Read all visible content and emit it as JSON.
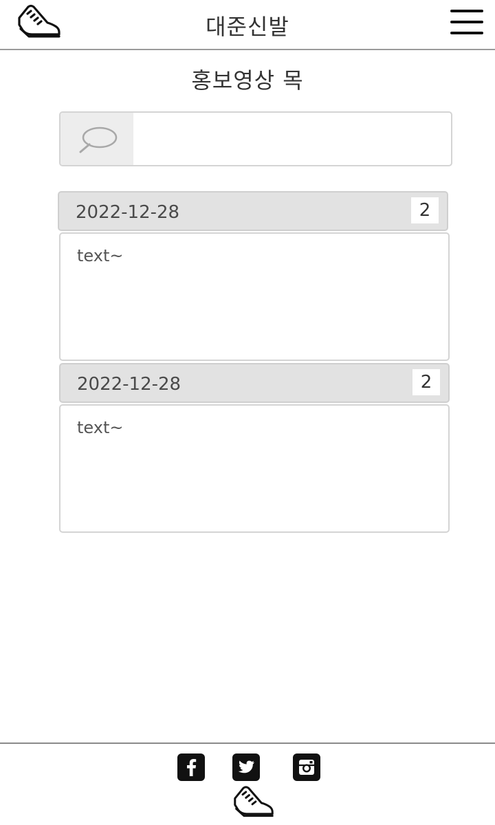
{
  "header": {
    "title": "대준신발",
    "logo_icon": "sneaker-icon",
    "menu_icon": "hamburger-menu-icon"
  },
  "page": {
    "title": "홍보영상 목"
  },
  "search": {
    "icon": "search-icon",
    "value": "",
    "placeholder": ""
  },
  "posts": [
    {
      "date": "2022-12-28",
      "count": "2",
      "text": "text~"
    },
    {
      "date": "2022-12-28",
      "count": "2",
      "text": "text~"
    }
  ],
  "footer": {
    "social_icons": [
      "facebook-icon",
      "twitter-icon",
      "instagram-icon"
    ],
    "logo_icon": "sneaker-icon"
  },
  "colors": {
    "header_border": "#9a9a9a",
    "post_header_bg": "#e2e2e2",
    "search_icon_bg": "#ededed",
    "social_icon_bg": "#111111",
    "text": "#333333"
  }
}
